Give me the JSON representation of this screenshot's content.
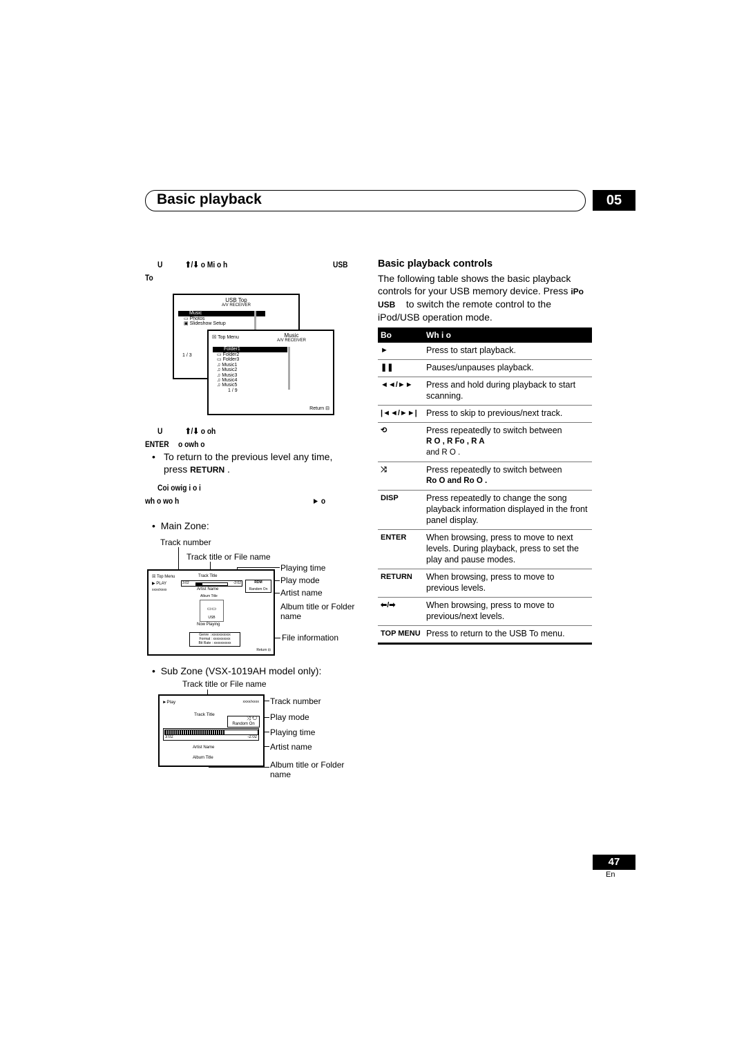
{
  "header": {
    "title": "Basic playback",
    "chapter": "05"
  },
  "left": {
    "step1": {
      "line1a": "U",
      "line1b": "⬆/⬇ o Mi o h",
      "line1c": "USB",
      "line2": "To"
    },
    "usb_top_screen": {
      "title": "USB Top",
      "subtitle": "A/V RECEIVER",
      "items": [
        "Music",
        "Photos",
        "Slideshow Setup"
      ],
      "page": "1 / 3"
    },
    "music_screen": {
      "top_menu": "Top Menu",
      "title": "Music",
      "subtitle": "A/V RECEIVER",
      "items": [
        "Folder1",
        "Folder2",
        "Folder3",
        "Music1",
        "Music2",
        "Music3",
        "Music4",
        "Music5"
      ],
      "page": "1 / 9",
      "return": "Return"
    },
    "step2": {
      "line1a": "U",
      "line1b": "⬆/⬇ o oh",
      "line2a": "ENTER",
      "line2b": "o owh o"
    },
    "bullet1": {
      "text": "To return to the previous level any time, press",
      "key": "RETURN",
      "end": "."
    },
    "step3": {
      "line1": "Coi owig i o i",
      "line2a": "wh o wo h",
      "line2b": "► o"
    },
    "main_zone": {
      "heading": "Main Zone:",
      "screen": {
        "top_menu": "Top Menu",
        "play": "PLAY",
        "track_no": "xxxx/xxxx",
        "track_title": "Track Title",
        "time_elapsed": "3:02",
        "time_remaining": "-2:02",
        "progress": 0.2,
        "mode_icon": "RDM",
        "mode": "Random On",
        "artist": "Artist Name",
        "album": "Album Title",
        "device": "USB",
        "now_playing": "Now Playing",
        "genre": "Genre : xxxxxxxxxxx",
        "format": "Format : xxxxxxxxxx",
        "bitrate": "Bit Rate : xxxxxxxxxx",
        "return": "Return"
      },
      "labels": {
        "track_number": "Track number",
        "track_title": "Track title or File name",
        "playing_time": "Playing time",
        "play_mode": "Play mode",
        "artist_name": "Artist name",
        "album_title": "Album title or Folder name",
        "file_info": "File information"
      }
    },
    "sub_zone": {
      "heading": "Sub Zone (VSX-1019AH model only):",
      "screen": {
        "play": "►Play",
        "track_no": "xxxx/xxxx",
        "track_title": "Track Title",
        "mode": "Random On",
        "time_elapsed": "3:02",
        "time_remaining": "-2:02",
        "progress": 0.65,
        "artist": "Artist Name",
        "album": "Album Title"
      },
      "labels": {
        "track_title": "Track title or File name",
        "track_number": "Track number",
        "play_mode": "Play mode",
        "playing_time": "Playing time",
        "artist_name": "Artist name",
        "album_title": "Album title or Folder name"
      }
    }
  },
  "right": {
    "heading": "Basic playback controls",
    "intro_a": "The following table shows the basic playback controls for your USB memory device. Press",
    "intro_key": "iPo USB",
    "intro_b": "to switch the remote control to the iPod/USB operation mode.",
    "table": {
      "headers": [
        "Bo",
        "Wh i o"
      ],
      "rows": [
        {
          "key": "►",
          "icon": "play-icon",
          "desc": "Press to start playback."
        },
        {
          "key": "❚❚",
          "icon": "pause-icon",
          "desc": "Pauses/unpauses playback."
        },
        {
          "key": "◄◄/►►",
          "icon": "scan-icon",
          "desc": "Press and hold during playback to start scanning."
        },
        {
          "key": "|◄◄/►►|",
          "icon": "skip-icon",
          "desc": "Press to skip to previous/next track."
        },
        {
          "key": "⟲",
          "icon": "repeat-icon",
          "desc": "Press repeatedly to switch between",
          "desc2": "R O          , R Fo          , R A",
          "desc3": "and R O        ."
        },
        {
          "key": "⤨",
          "icon": "shuffle-icon",
          "desc": "Press repeatedly to switch between",
          "desc2": "Ro O and Ro O                    ."
        },
        {
          "key": "DISP",
          "desc": "Press repeatedly to change the song playback information displayed in the front panel display."
        },
        {
          "key": "ENTER",
          "desc": "When browsing, press to move to next levels. During playback, press to set the play and pause modes."
        },
        {
          "key": "RETURN",
          "desc": "When browsing, press to move to previous levels."
        },
        {
          "key": "⬅/➡",
          "icon": "left-right-arrows-icon",
          "desc": "When browsing, press to move to previous/next levels."
        },
        {
          "key": "TOP MENU",
          "desc": "Press to return to the USB To menu."
        }
      ]
    }
  },
  "footer": {
    "page_number": "47",
    "language": "En"
  }
}
